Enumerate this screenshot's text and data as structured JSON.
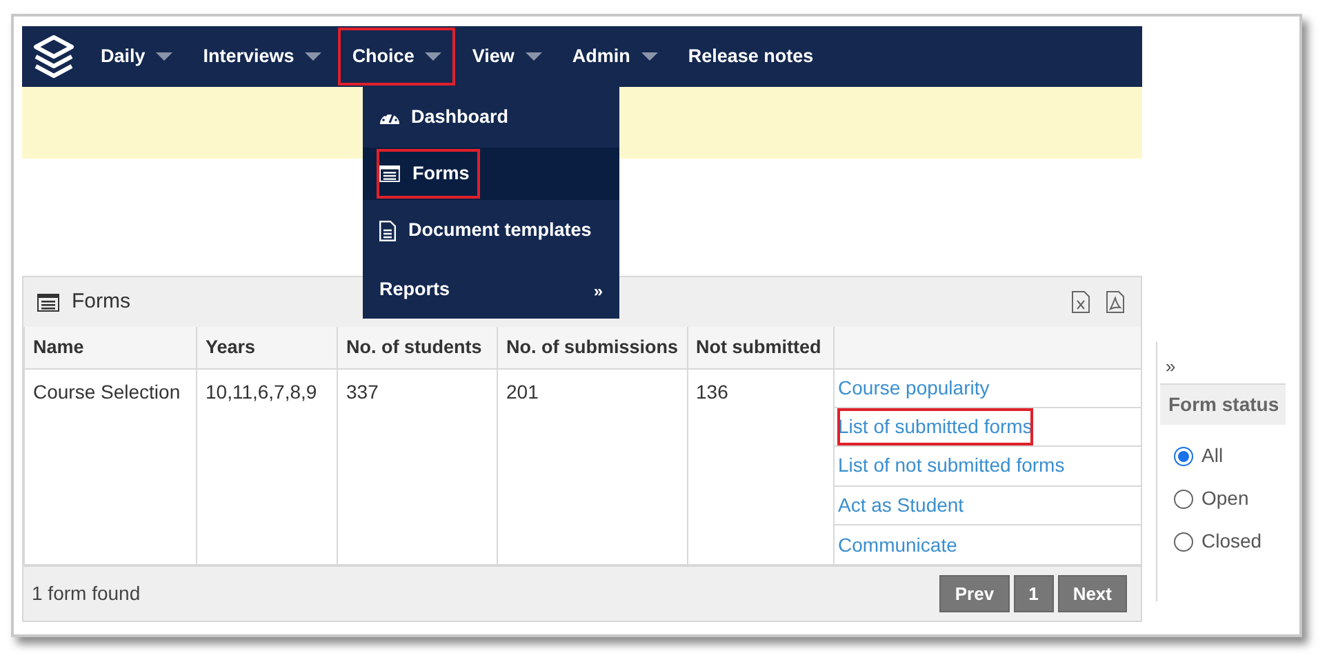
{
  "nav": {
    "items": [
      {
        "label": "Daily",
        "has_menu": true,
        "highlighted": false
      },
      {
        "label": "Interviews",
        "has_menu": true,
        "highlighted": false
      },
      {
        "label": "Choice",
        "has_menu": true,
        "highlighted": true
      },
      {
        "label": "View",
        "has_menu": true,
        "highlighted": false
      },
      {
        "label": "Admin",
        "has_menu": true,
        "highlighted": false
      },
      {
        "label": "Release notes",
        "has_menu": false,
        "highlighted": false
      }
    ]
  },
  "dropdown": {
    "items": [
      {
        "kind": "dashboard",
        "label": "Dashboard",
        "selected": false,
        "highlighted": false
      },
      {
        "kind": "forms",
        "label": "Forms",
        "selected": true,
        "highlighted": true
      },
      {
        "kind": "document",
        "label": "Document templates",
        "selected": false,
        "highlighted": false
      },
      {
        "kind": "submenu",
        "label": "Reports",
        "arrow": "»",
        "selected": false,
        "highlighted": false
      }
    ]
  },
  "panel": {
    "title": "Forms",
    "columns": [
      "Name",
      "Years",
      "No. of students",
      "No. of submissions",
      "Not submitted"
    ],
    "rows": [
      {
        "cells": [
          "Course Selection",
          "10,11,6,7,8,9",
          "337",
          "201",
          "136"
        ],
        "actions": [
          {
            "label": "Course popularity",
            "highlighted": false
          },
          {
            "label": "List of submitted forms",
            "highlighted": true
          },
          {
            "label": "List of not submitted forms",
            "highlighted": false
          },
          {
            "label": "Act as Student",
            "highlighted": false
          },
          {
            "label": "Communicate",
            "highlighted": false
          }
        ]
      }
    ],
    "footer": "1 form found",
    "pagination": [
      "Prev",
      "1",
      "Next"
    ]
  },
  "sidebar": {
    "toggle": "»",
    "title": "Form status",
    "options": [
      {
        "label": "All",
        "selected": true
      },
      {
        "label": "Open",
        "selected": false
      },
      {
        "label": "Closed",
        "selected": false
      }
    ]
  }
}
